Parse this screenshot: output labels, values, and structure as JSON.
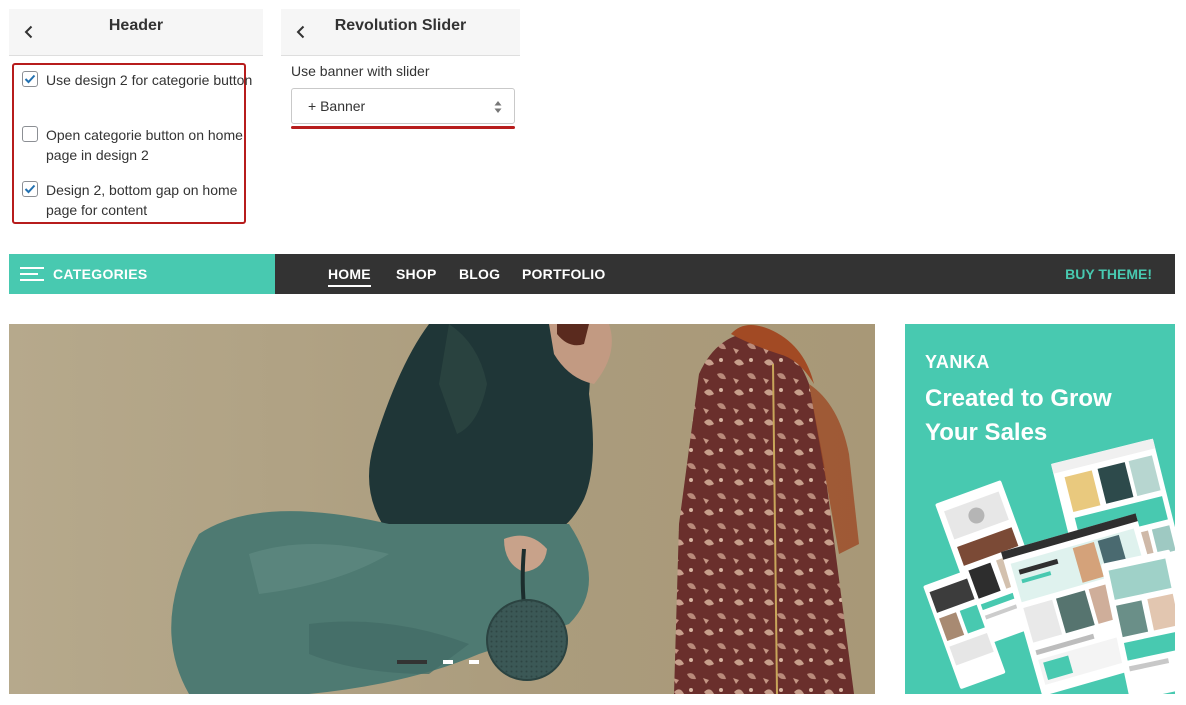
{
  "header_panel": {
    "title": "Header"
  },
  "options": [
    {
      "label": "Use design 2 for categorie button",
      "checked": true
    },
    {
      "label": "Open categorie button on home page in design 2",
      "checked": false
    },
    {
      "label": "Design 2, bottom gap on home page for content",
      "checked": true
    }
  ],
  "slider_panel": {
    "title": "Revolution Slider",
    "field_label": "Use banner with slider",
    "select_value": "+ Banner"
  },
  "nav": {
    "categories_label": "CATEGORIES",
    "links": [
      "HOME",
      "SHOP",
      "BLOG",
      "PORTFOLIO"
    ],
    "active_link": "HOME",
    "buy_label": "BUY THEME!"
  },
  "promo": {
    "brand": "YANKA",
    "headline": "Created to Grow Your Sales"
  },
  "slider_dots": {
    "count": 3,
    "active_index": 0
  },
  "colors": {
    "accent": "#48c9b0",
    "nav_dark": "#333333",
    "highlight_red": "#b71c1c"
  },
  "icons": {
    "back": "chevron-left-icon",
    "menu": "hamburger-icon",
    "select": "sort-arrows-icon",
    "check": "checkmark-icon"
  }
}
